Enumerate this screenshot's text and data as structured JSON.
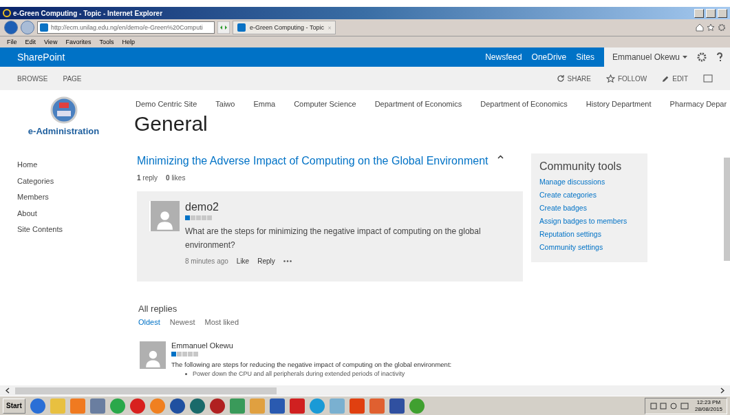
{
  "window": {
    "title": "e-Green Computing - Topic - Internet Explorer"
  },
  "browser": {
    "address": "http://ecm.unilag.edu.ng/en/demo/e-Green%20Computi",
    "tab": "e-Green Computing - Topic",
    "menu": [
      "File",
      "Edit",
      "View",
      "Favorites",
      "Tools",
      "Help"
    ]
  },
  "suite_bar": {
    "brand": "SharePoint",
    "links": [
      {
        "label": "Newsfeed"
      },
      {
        "label": "OneDrive"
      },
      {
        "label": "Sites"
      }
    ],
    "user": "Emmanuel Okewu"
  },
  "ribbon": {
    "tabs": [
      "BROWSE",
      "PAGE"
    ],
    "actions": [
      {
        "kind": "share",
        "label": "SHARE"
      },
      {
        "kind": "follow",
        "label": "FOLLOW"
      },
      {
        "kind": "edit",
        "label": "EDIT"
      }
    ]
  },
  "site": {
    "logo_text": "e-Administration",
    "top_nav": [
      "Demo Centric Site",
      "Taiwo",
      "Emma",
      "Computer Science",
      "Department of Economics",
      "Department of Economics",
      "History Department",
      "Pharmacy Depar"
    ],
    "page_title": "General"
  },
  "left_nav": [
    "Home",
    "Categories",
    "Members",
    "About",
    "Site Contents"
  ],
  "topic": {
    "title": "Minimizing the Adverse Impact of Computing on the Global Environment",
    "replies_count": "1",
    "replies_label": "reply",
    "likes_count": "0",
    "likes_label": "likes",
    "post": {
      "author": "demo2",
      "stars": 1,
      "text": "What are the steps for minimizing the negative impact of computing on the global environment?",
      "time": "8 minutes ago",
      "actions": [
        "Like",
        "Reply"
      ]
    }
  },
  "replies": {
    "heading": "All replies",
    "sort": [
      {
        "label": "Oldest",
        "selected": true
      },
      {
        "label": "Newest",
        "selected": false
      },
      {
        "label": "Most liked",
        "selected": false
      }
    ],
    "items": [
      {
        "author": "Emmanuel Okewu",
        "stars": 1,
        "text": "The following are steps for reducing the negative impact of computing on the global environment:",
        "bullets": [
          "Power down the CPU and all peripherals during extended periods of inactivity"
        ]
      }
    ]
  },
  "community_tools": {
    "title": "Community tools",
    "links": [
      "Manage discussions",
      "Create categories",
      "Create badges",
      "Assign badges to members",
      "Reputation settings",
      "Community settings"
    ]
  },
  "taskbar": {
    "start": "Start",
    "time": "12:23 PM",
    "date": "28/08/2015"
  }
}
